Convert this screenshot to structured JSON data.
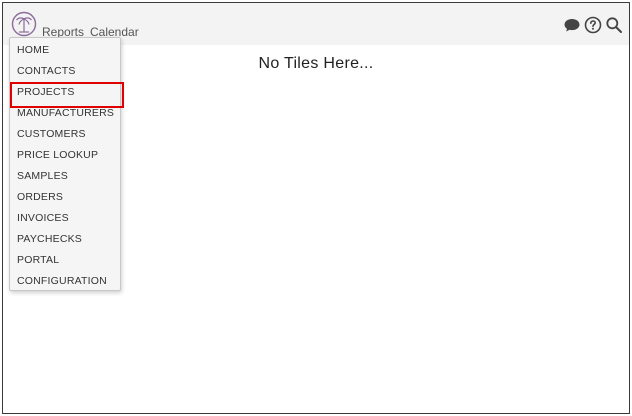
{
  "header": {
    "logo_icon": "palm-tree-logo-icon",
    "nav": [
      {
        "label": "Reports"
      },
      {
        "label": "Calendar"
      }
    ],
    "icons": [
      "chat-icon",
      "help-icon",
      "search-icon"
    ]
  },
  "main": {
    "empty_message": "No Tiles Here..."
  },
  "menu": {
    "highlighted_index": 2,
    "highlight_color": "#e00000",
    "items": [
      {
        "label": "HOME"
      },
      {
        "label": "CONTACTS"
      },
      {
        "label": "PROJECTS"
      },
      {
        "label": "MANUFACTURERS"
      },
      {
        "label": "CUSTOMERS"
      },
      {
        "label": "PRICE LOOKUP"
      },
      {
        "label": "SAMPLES"
      },
      {
        "label": "ORDERS"
      },
      {
        "label": "INVOICES"
      },
      {
        "label": "PAYCHECKS"
      },
      {
        "label": "PORTAL"
      },
      {
        "label": "CONFIGURATION"
      }
    ]
  },
  "colors": {
    "logo": "#8a6b9a",
    "topbar_bg": "#f3f3f3",
    "icon": "#444444"
  }
}
